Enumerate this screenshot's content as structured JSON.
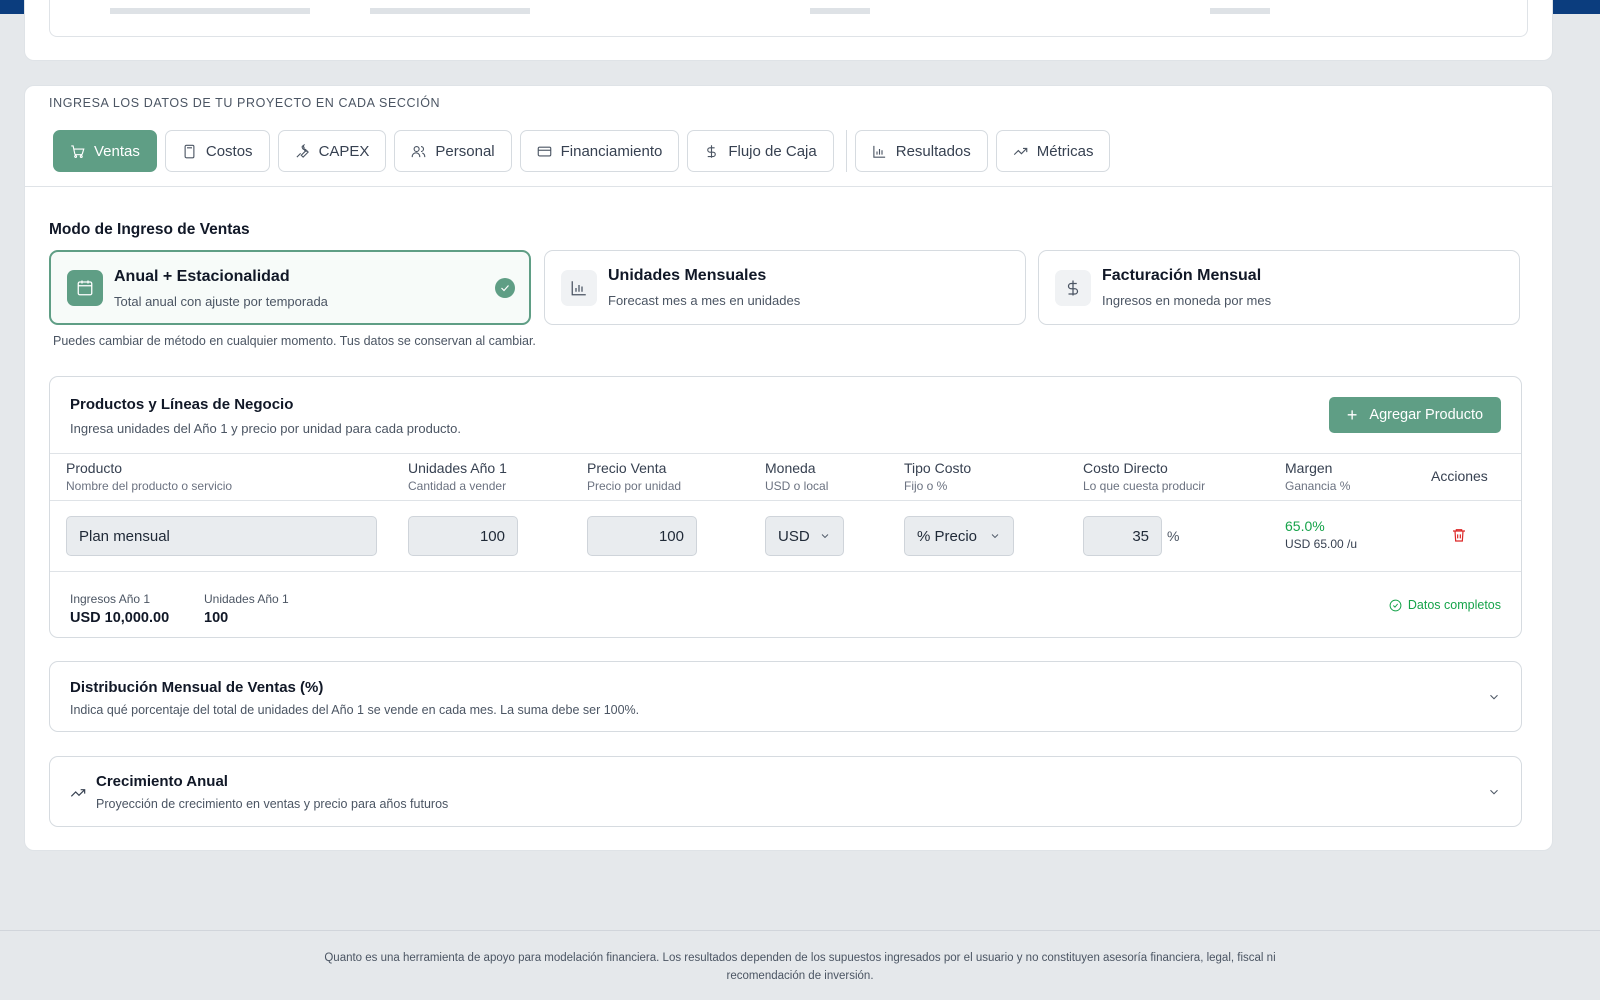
{
  "section_caption": "INGRESA LOS DATOS DE TU PROYECTO EN CADA SECCIÓN",
  "tabs": [
    {
      "label": "Ventas",
      "icon": "cart-icon",
      "active": true
    },
    {
      "label": "Costos",
      "icon": "calculator-icon"
    },
    {
      "label": "CAPEX",
      "icon": "wrench-icon"
    },
    {
      "label": "Personal",
      "icon": "users-icon"
    },
    {
      "label": "Financiamiento",
      "icon": "credit-card-icon"
    },
    {
      "label": "Flujo de Caja",
      "icon": "dollar-icon"
    },
    {
      "label": "Resultados",
      "icon": "bar-chart-icon"
    },
    {
      "label": "Métricas",
      "icon": "trending-up-icon"
    }
  ],
  "mode": {
    "title": "Modo de Ingreso de Ventas",
    "options": [
      {
        "name": "Anual + Estacionalidad",
        "desc": "Total anual con ajuste por temporada",
        "icon": "calendar-icon",
        "selected": true
      },
      {
        "name": "Unidades Mensuales",
        "desc": "Forecast mes a mes en unidades",
        "icon": "bar-chart-icon"
      },
      {
        "name": "Facturación Mensual",
        "desc": "Ingresos en moneda por mes",
        "icon": "dollar-icon"
      }
    ],
    "note": "Puedes cambiar de método en cualquier momento. Tus datos se conservan al cambiar."
  },
  "products": {
    "title": "Productos y Líneas de Negocio",
    "subtitle": "Ingresa unidades del Año 1 y precio por unidad para cada producto.",
    "add_label": "Agregar Producto",
    "columns": [
      {
        "h": "Producto",
        "s": "Nombre del producto o servicio"
      },
      {
        "h": "Unidades Año 1",
        "s": "Cantidad a vender"
      },
      {
        "h": "Precio Venta",
        "s": "Precio por unidad"
      },
      {
        "h": "Moneda",
        "s": "USD o local"
      },
      {
        "h": "Tipo Costo",
        "s": "Fijo o %"
      },
      {
        "h": "Costo Directo",
        "s": "Lo que cuesta producir"
      },
      {
        "h": "Margen",
        "s": "Ganancia %"
      },
      {
        "h": "Acciones",
        "s": ""
      }
    ],
    "row": {
      "name": "Plan mensual",
      "units": "100",
      "price": "100",
      "currency": "USD",
      "cost_type": "% Precio",
      "direct_cost": "35",
      "direct_cost_unit": "%",
      "margin_pct": "65.0%",
      "margin_unit": "USD 65.00 /u"
    },
    "summary": {
      "revenue_label": "Ingresos Año 1",
      "revenue_value": "USD 10,000.00",
      "units_label": "Unidades Año 1",
      "units_value": "100",
      "status": "Datos completos"
    }
  },
  "distribution": {
    "title": "Distribución Mensual de Ventas (%)",
    "subtitle": "Indica qué porcentaje del total de unidades del Año 1 se vende en cada mes. La suma debe ser 100%."
  },
  "growth": {
    "title": "Crecimiento Anual",
    "subtitle": "Proyección de crecimiento en ventas y precio para años futuros"
  },
  "footer": {
    "text": "Quanto es una herramienta de apoyo para modelación financiera. Los resultados dependen de los supuestos ingresados por el usuario y no constituyen asesoría financiera, legal, fiscal ni recomendación de inversión."
  },
  "colors": {
    "accent": "#5f9e85",
    "topbar": "#0b3d7e",
    "success": "#16a34a",
    "danger": "#dc2626"
  }
}
